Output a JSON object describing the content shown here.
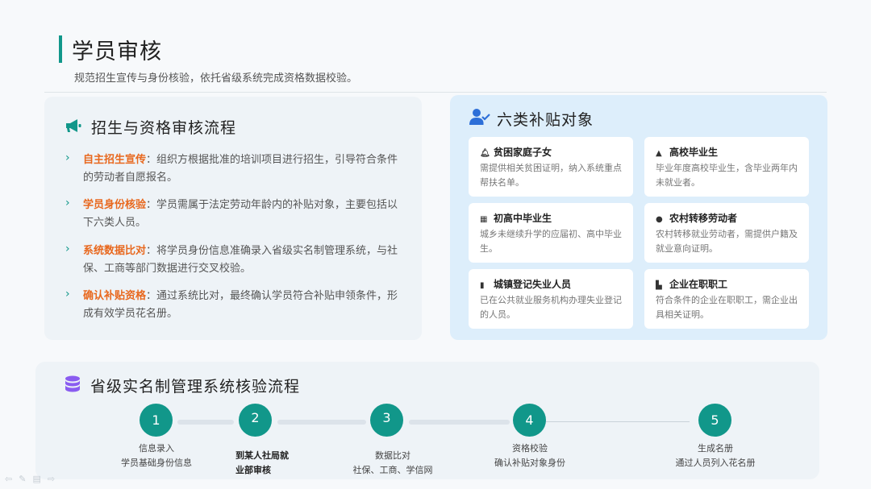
{
  "header": {
    "title": "学员审核",
    "subtitle": "规范招生宣传与身份核验，依托省级系统完成资格数据校验。"
  },
  "left": {
    "icon": "megaphone-icon",
    "title": "招生与资格审核流程",
    "items": [
      {
        "label": "自主招生宣传",
        "text": "：组织方根据批准的培训项目进行招生，引导符合条件的劳动者自愿报名。"
      },
      {
        "label": "学员身份核验",
        "text": "：学员需属于法定劳动年龄内的补贴对象，主要包括以下六类人员。"
      },
      {
        "label": "系统数据比对",
        "text": "：将学员身份信息准确录入省级实名制管理系统，与社保、工商等部门数据进行交叉校验。"
      },
      {
        "label": "确认补贴资格",
        "text": "：通过系统比对，最终确认学员符合补贴申领条件，形成有效学员花名册。"
      }
    ]
  },
  "right": {
    "icon": "user-check-icon",
    "title": "六类补贴对象",
    "cards": [
      {
        "icon": "bell-icon",
        "title": "贫困家庭子女",
        "desc": "需提供相关贫困证明，纳入系统重点帮扶名单。"
      },
      {
        "icon": "graduation-cap-icon",
        "title": "高校毕业生",
        "desc": "毕业年度高校毕业生，含毕业两年内未就业者。"
      },
      {
        "icon": "school-icon",
        "title": "初高中毕业生",
        "desc": "城乡未继续升学的应届初、高中毕业生。"
      },
      {
        "icon": "tractor-icon",
        "title": "农村转移劳动者",
        "desc": "农村转移就业劳动者，需提供户籍及就业意向证明。"
      },
      {
        "icon": "document-icon",
        "title": "城镇登记失业人员",
        "desc": "已在公共就业服务机构办理失业登记的人员。"
      },
      {
        "icon": "factory-icon",
        "title": "企业在职职工",
        "desc": "符合条件的企业在职职工，需企业出具相关证明。"
      }
    ]
  },
  "bottom": {
    "icon": "database-icon",
    "title": "省级实名制管理系统核验流程",
    "steps": [
      {
        "num": "1",
        "line1": "信息录入",
        "line2": "学员基础身份信息"
      },
      {
        "num": "2",
        "line1": "到某人社局就",
        "line2": "业部审核"
      },
      {
        "num": "3",
        "line1": "数据比对",
        "line2": "社保、工商、学信网"
      },
      {
        "num": "4",
        "line1": "资格校验",
        "line2": "确认补贴对象身份"
      },
      {
        "num": "5",
        "line1": "生成名册",
        "line2": "通过人员列入花名册"
      }
    ]
  },
  "colors": {
    "accent": "#11978a",
    "highlight": "#e8681e",
    "icon_blue": "#2d6fd8",
    "icon_purple": "#8a5cf0"
  }
}
